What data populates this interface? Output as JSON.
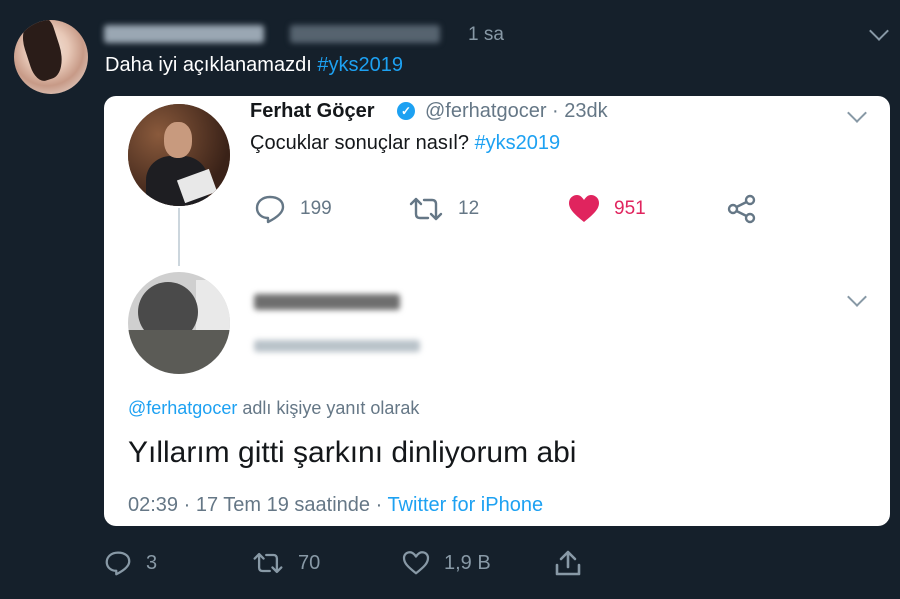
{
  "outer_tweet": {
    "time": "1 sa",
    "text": "Daha iyi açıklanamazdı",
    "hashtag": "#yks2019"
  },
  "quoted_tweet": {
    "name": "Ferhat Göçer",
    "handle_time": "@ferhatgocer · 23dk",
    "text": "Çocuklar sonuçlar nasıl?",
    "hashtag": "#yks2019",
    "replies": "199",
    "retweets": "12",
    "likes": "951"
  },
  "reply": {
    "reply_prefix": "@ferhatgocer",
    "reply_suffix": "adlı kişiye yanıt olarak",
    "text": "Yıllarım gitti şarkını dinliyorum abi",
    "meta": "02:39 · 17 Tem 19 saatinde · ",
    "source": "Twitter for iPhone"
  },
  "outer_actions": {
    "replies": "3",
    "retweets": "70",
    "likes": "1,9 B"
  },
  "icons": [
    "reply-icon",
    "retweet-icon",
    "heart-icon",
    "share-icon",
    "verified-icon",
    "chevron-down-icon"
  ],
  "colors": {
    "background": "#15202b",
    "link": "#1da1f2",
    "like": "#e0245e"
  }
}
